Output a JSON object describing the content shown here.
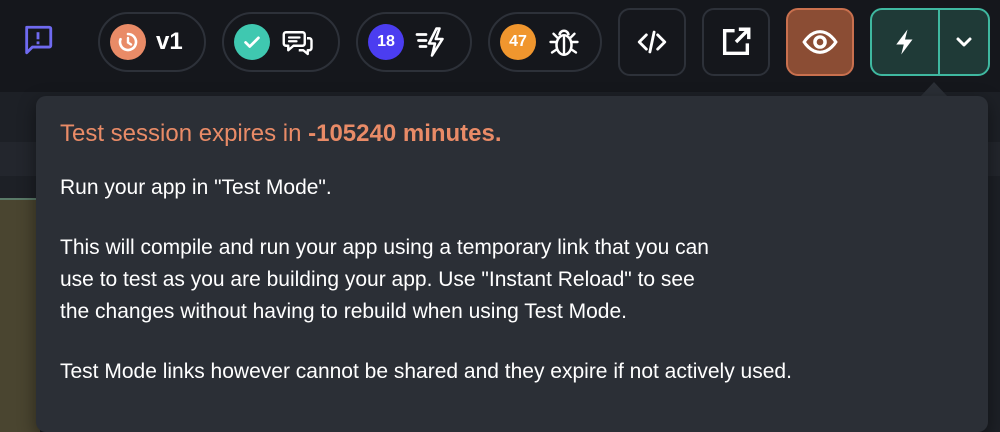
{
  "toolbar": {
    "version_badge": {
      "label": "v1",
      "color": "#e98b67"
    },
    "comments": {
      "check_color": "#3fc8b0"
    },
    "actions_badge": {
      "count": "18",
      "color": "#4b3df0"
    },
    "issues_badge": {
      "count": "47",
      "color": "#f0962e"
    },
    "accent_run": "#3fb8a0",
    "accent_preview": "#c9704e"
  },
  "tooltip": {
    "expiry_prefix": "Test session expires in ",
    "expiry_minutes": "-105240 minutes.",
    "para1": "Run your app in \"Test Mode\".",
    "para2_lines": [
      "This will compile and run your app using a temporary link that you can",
      "use to test as you are building your app. Use \"Instant Reload\" to see",
      "the changes without having to rebuild when using Test Mode."
    ],
    "para3": "Test Mode links however cannot be shared and they expire if not actively used."
  }
}
